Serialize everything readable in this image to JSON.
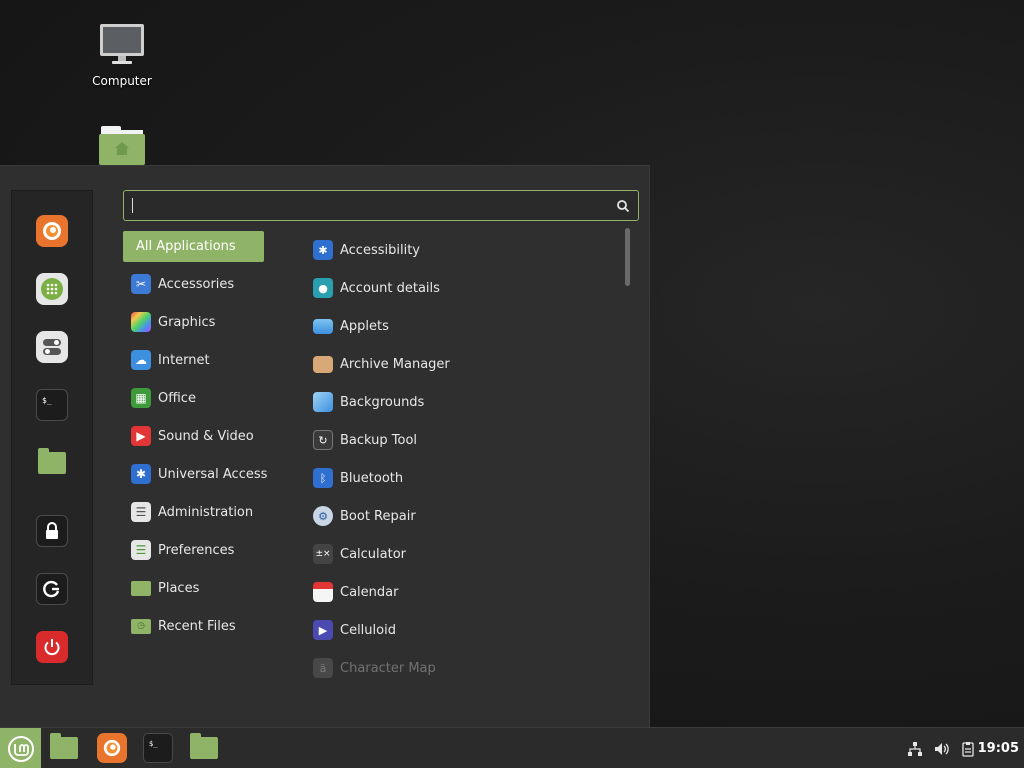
{
  "desktop": {
    "icons": [
      {
        "label": "Computer",
        "icon": "monitor-icon"
      },
      {
        "label": "",
        "icon": "home-folder-icon"
      }
    ]
  },
  "menu": {
    "search": {
      "value": "",
      "placeholder": ""
    },
    "favorites": [
      {
        "name": "firefox",
        "icon": "firefox-icon"
      },
      {
        "name": "software-manager",
        "icon": "software-manager-icon"
      },
      {
        "name": "system-settings",
        "icon": "settings-toggle-icon"
      },
      {
        "name": "terminal",
        "icon": "terminal-icon"
      },
      {
        "name": "files",
        "icon": "folder-icon"
      },
      {
        "name": "lock-screen",
        "icon": "lock-icon"
      },
      {
        "name": "logout",
        "icon": "logout-icon"
      },
      {
        "name": "quit",
        "icon": "power-icon"
      }
    ],
    "categories": [
      {
        "label": "All Applications",
        "icon": "",
        "active": true
      },
      {
        "label": "Accessories",
        "icon": "scissors-icon"
      },
      {
        "label": "Graphics",
        "icon": "graphics-icon"
      },
      {
        "label": "Internet",
        "icon": "cloud-icon"
      },
      {
        "label": "Office",
        "icon": "office-icon"
      },
      {
        "label": "Sound & Video",
        "icon": "play-icon"
      },
      {
        "label": "Universal Access",
        "icon": "accessibility-icon"
      },
      {
        "label": "Administration",
        "icon": "admin-toggle-icon"
      },
      {
        "label": "Preferences",
        "icon": "preferences-toggle-icon"
      },
      {
        "label": "Places",
        "icon": "folder-icon"
      },
      {
        "label": "Recent Files",
        "icon": "recent-folder-icon"
      }
    ],
    "applications": [
      {
        "label": "Accessibility",
        "icon": "accessibility-icon"
      },
      {
        "label": "Account details",
        "icon": "user-icon"
      },
      {
        "label": "Applets",
        "icon": "applets-icon"
      },
      {
        "label": "Archive Manager",
        "icon": "archive-icon"
      },
      {
        "label": "Backgrounds",
        "icon": "backgrounds-icon"
      },
      {
        "label": "Backup Tool",
        "icon": "backup-icon"
      },
      {
        "label": "Bluetooth",
        "icon": "bluetooth-icon"
      },
      {
        "label": "Boot Repair",
        "icon": "boot-repair-icon"
      },
      {
        "label": "Calculator",
        "icon": "calculator-icon"
      },
      {
        "label": "Calendar",
        "icon": "calendar-icon"
      },
      {
        "label": "Celluloid",
        "icon": "celluloid-icon"
      },
      {
        "label": "Character Map",
        "icon": "character-map-icon"
      }
    ]
  },
  "panel": {
    "launchers": [
      {
        "name": "files",
        "icon": "folder-icon"
      },
      {
        "name": "firefox",
        "icon": "firefox-icon"
      },
      {
        "name": "terminal",
        "icon": "terminal-icon"
      },
      {
        "name": "folder",
        "icon": "folder-icon"
      }
    ],
    "tray": [
      {
        "name": "network",
        "icon": "network-icon"
      },
      {
        "name": "volume",
        "icon": "volume-icon"
      },
      {
        "name": "clipboard",
        "icon": "clipboard-icon"
      }
    ],
    "clock": "19:05"
  },
  "colors": {
    "accent": "#8fb468",
    "menu_bg": "#2f2f2f",
    "panel_bg": "#2b2b2b"
  }
}
